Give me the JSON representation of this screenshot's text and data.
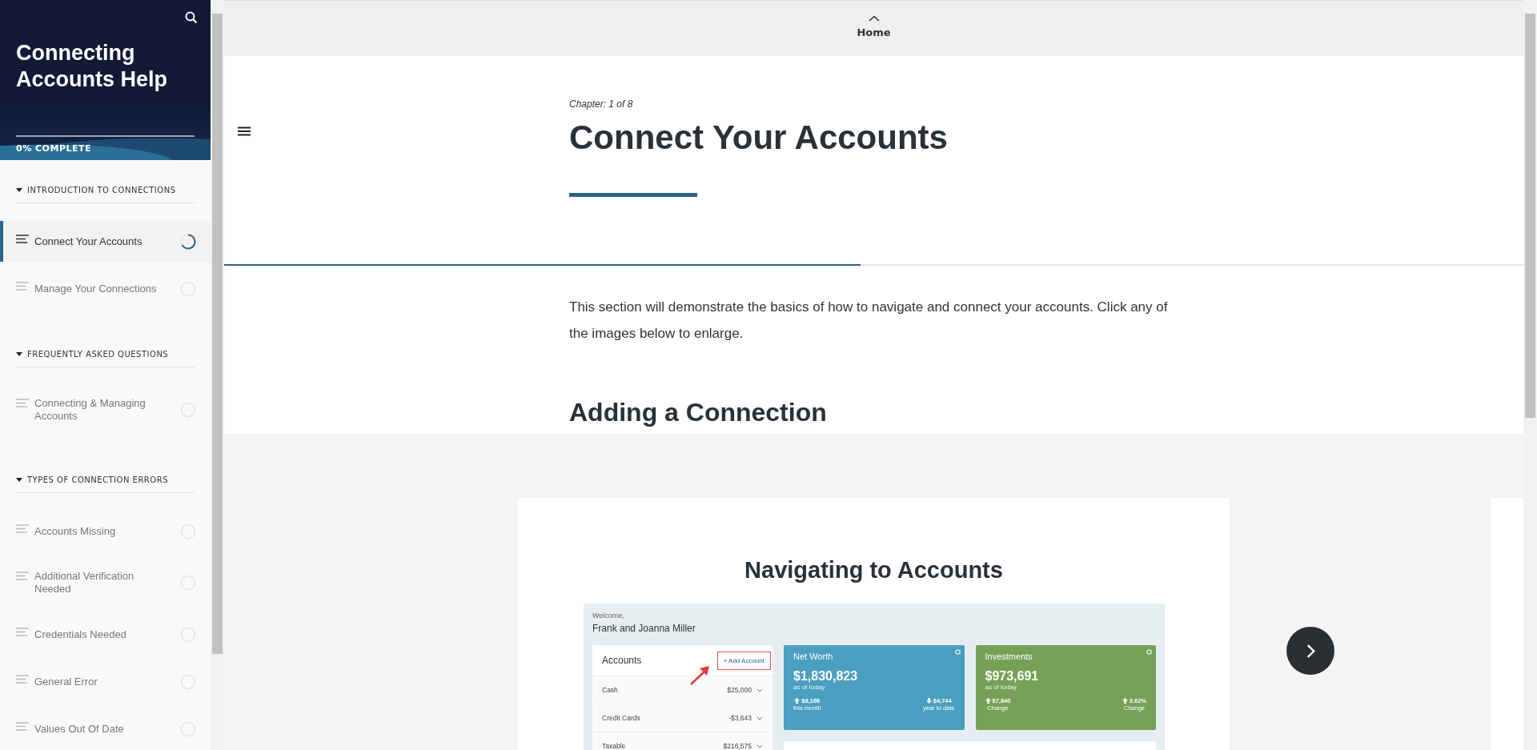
{
  "sidebar": {
    "title": "Connecting Accounts Help",
    "progress_label": "0% COMPLETE",
    "level": 0,
    "sections": [
      {
        "title": "INTRODUCTION TO CONNECTIONS",
        "expanded": true,
        "items": [
          {
            "label": "Connect Your Accounts",
            "selected": true,
            "started": true
          },
          {
            "label": "Manage Your Connections",
            "selected": false,
            "started": false
          }
        ]
      },
      {
        "title": "FREQUENTLY ASKED QUESTIONS",
        "expanded": true,
        "items": [
          {
            "label": "Connecting & Managing Accounts",
            "selected": false,
            "started": false
          }
        ]
      },
      {
        "title": "TYPES OF CONNECTION ERRORS",
        "expanded": true,
        "items": [
          {
            "label": "Accounts Missing",
            "selected": false,
            "started": false
          },
          {
            "label": "Additional Verification Needed",
            "selected": false,
            "started": false
          },
          {
            "label": "Credentials Needed",
            "selected": false,
            "started": false
          },
          {
            "label": "General Error",
            "selected": false,
            "started": false
          },
          {
            "label": "Values Out Of Date",
            "selected": false,
            "started": false
          }
        ]
      }
    ]
  },
  "top_bar": {
    "home_label": "Home"
  },
  "lesson": {
    "chapter": "Chapter: 1 of 8",
    "title": "Connect Your Accounts",
    "level": 0.49,
    "intro": "This section will demonstrate the basics of how to navigate and connect your accounts. Click any of the images below to enlarge.",
    "heading": "Adding a Connection"
  },
  "carousel": {
    "card_title": "Navigating to Accounts",
    "app_screenshot": {
      "greeting": "Welcome,",
      "user_name": "Frank and Joanna Miller",
      "accounts": {
        "title": "Accounts",
        "add_button": "+ Add Account",
        "rows": [
          {
            "name": "Cash",
            "value": "$25,000"
          },
          {
            "name": "Credit Cards",
            "value": "-$3,643"
          },
          {
            "name": "Taxable",
            "value": "$216,575"
          }
        ]
      },
      "tiles": [
        {
          "title": "Net Worth",
          "color": "#4a9fc0",
          "amount": "$1,830,823",
          "note": "as of today",
          "left": {
            "increase": true,
            "value": "$8,166",
            "caption": "this month"
          },
          "right": {
            "increase": false,
            "value": "$4,744",
            "caption": "year to date"
          }
        },
        {
          "title": "Investments",
          "color": "#76a056",
          "amount": "$973,691",
          "note": "as of today",
          "left": {
            "increase": true,
            "value": "$7,840",
            "caption": "Change"
          },
          "right": {
            "increase": true,
            "value": "3.62%",
            "caption": "Change"
          }
        }
      ]
    }
  }
}
